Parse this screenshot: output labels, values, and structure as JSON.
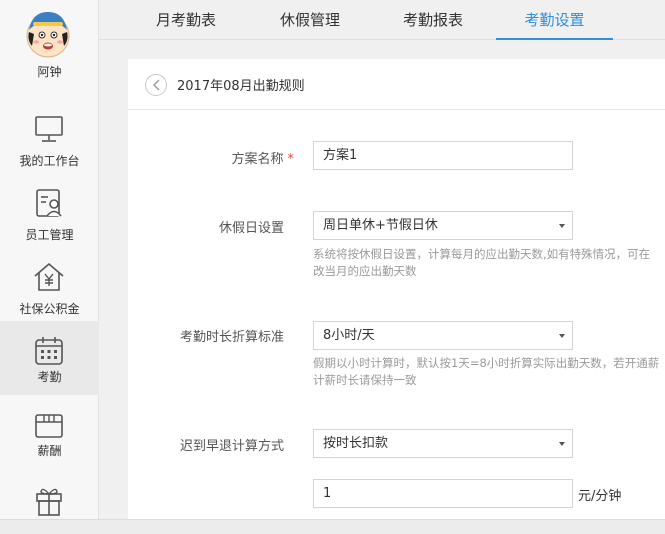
{
  "user": {
    "name": "阿钟"
  },
  "sidebar": {
    "items": [
      {
        "label": "我的工作台",
        "icon": "monitor-icon"
      },
      {
        "label": "员工管理",
        "icon": "employee-card-icon"
      },
      {
        "label": "社保公积金",
        "icon": "house-yen-icon"
      },
      {
        "label": "考勤",
        "icon": "calendar-icon"
      },
      {
        "label": "薪酬",
        "icon": "wallet-icon"
      },
      {
        "label": "",
        "icon": "gift-icon"
      }
    ],
    "active_index": 3
  },
  "tabs": [
    {
      "label": "月考勤表"
    },
    {
      "label": "休假管理"
    },
    {
      "label": "考勤报表"
    },
    {
      "label": "考勤设置"
    }
  ],
  "active_tab": 3,
  "panel": {
    "title": "2017年08月出勤规则",
    "back_icon": "chevron-left-icon"
  },
  "form": {
    "scheme_name": {
      "label": "方案名称",
      "required_mark": "*",
      "value": "方案1"
    },
    "holiday_setting": {
      "label": "休假日设置",
      "value": "周日单休+节假日休",
      "hint_line1": "系统将按休假日设置，计算每月的应出勤天数,如有特殊情况，可在",
      "hint_line2": "改当月的应出勤天数"
    },
    "duration_standard": {
      "label": "考勤时长折算标准",
      "value": "8小时/天",
      "hint_line1": "假期以小时计算时，默认按1天=8小时折算实际出勤天数，若开通薪",
      "hint_line2": "计薪时长请保持一致"
    },
    "late_method": {
      "label": "迟到早退计算方式",
      "value": "按时长扣款"
    },
    "deduction_amount": {
      "value": "1",
      "unit": "元/分钟"
    }
  },
  "colors": {
    "accent": "#2f8fd8",
    "required": "#e74c3c",
    "hint": "#9a9a9a"
  }
}
